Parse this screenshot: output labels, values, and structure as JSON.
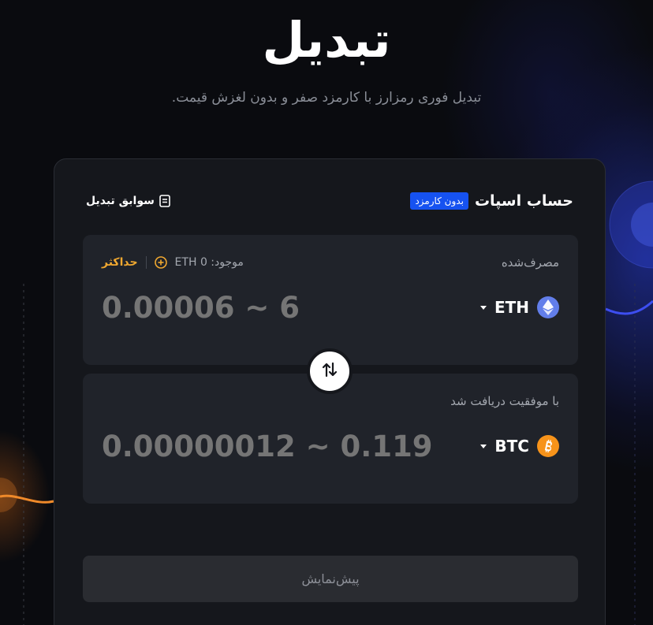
{
  "header": {
    "title": "تبدیل",
    "subtitle": "تبدیل فوری رمزارز با کارمزد صفر و بدون لغزش قیمت."
  },
  "card": {
    "account_title": "حساب اسپات",
    "fee_badge": "بدون کارمزد",
    "history_label": "سوابق تبدیل",
    "history_icon": "document-icon"
  },
  "from": {
    "label": "مصرف‌شده",
    "balance": "موجود: 0 ETH",
    "max_label": "حداکثر",
    "placeholder": "0.00006 ~ 6",
    "coin": "ETH",
    "coin_color": "#627eea"
  },
  "to": {
    "label": "با موفقیت دریافت شد",
    "placeholder": "0.00000012 ~ 0.119",
    "coin": "BTC",
    "coin_color": "#f7931a"
  },
  "swap_icon": "swap-arrows-icon",
  "preview_button": "پیش‌نمایش",
  "colors": {
    "accent_blue": "#1652f0",
    "accent_orange": "#f0a830",
    "card_bg": "#15171c",
    "panel_bg": "#20232a"
  }
}
